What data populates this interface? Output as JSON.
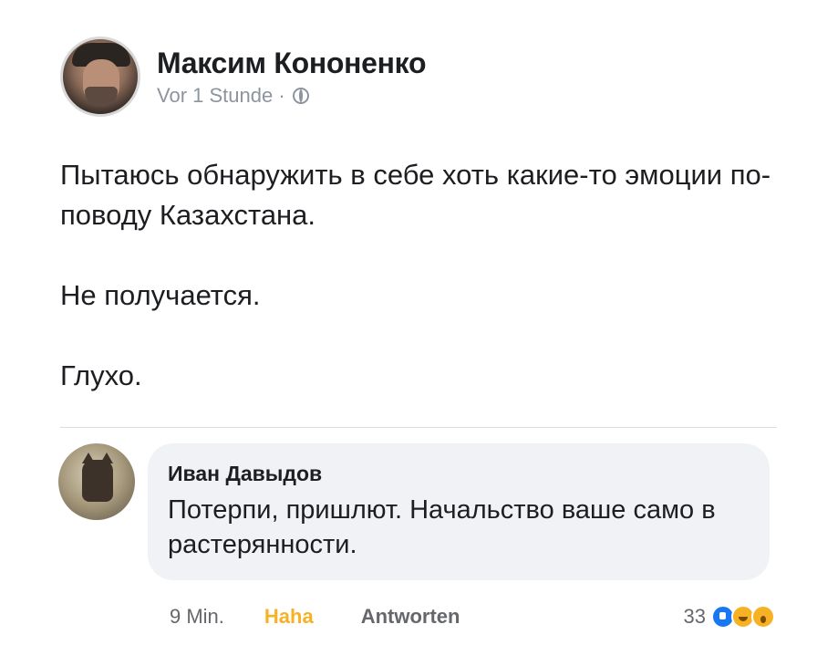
{
  "post": {
    "author": "Максим Кононенко",
    "time": "Vor 1 Stunde · ",
    "audience_icon": "globe-icon",
    "paragraphs": [
      "Пытаюсь обнаружить в себе хоть какие-то эмоции по-поводу Казахстана.",
      "Не получается.",
      "Глухо."
    ]
  },
  "comment": {
    "author": "Иван Давыдов",
    "text": "Потерпи, пришлют. Начальство ваше само в растерянности.",
    "time": "9 Min.",
    "reaction_label": "Haha",
    "reply_label": "Antworten",
    "reaction_count": "33",
    "reaction_icons": [
      "like-icon",
      "haha-icon",
      "wow-icon"
    ]
  },
  "colors": {
    "haha": "#f7b125",
    "like": "#1877f2",
    "bubble": "#f0f2f5",
    "muted": "#65676b"
  }
}
